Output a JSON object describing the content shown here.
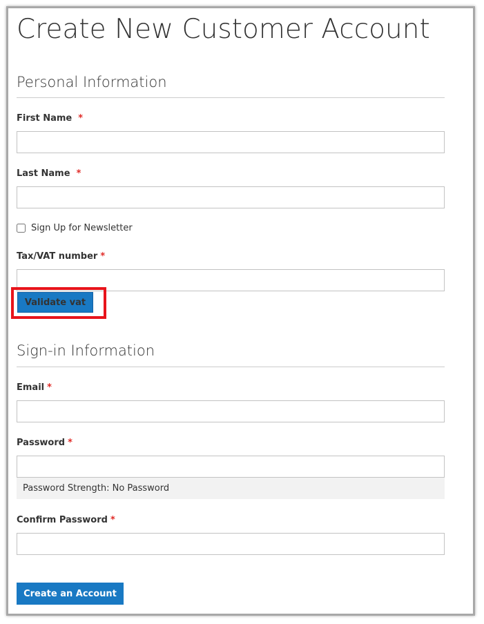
{
  "page": {
    "title": "Create New Customer Account"
  },
  "personal": {
    "section_title": "Personal Information",
    "first_name": {
      "label": "First Name",
      "required_mark": "*",
      "value": "",
      "placeholder": ""
    },
    "last_name": {
      "label": "Last Name",
      "required_mark": "*",
      "value": "",
      "placeholder": ""
    },
    "newsletter": {
      "label": "Sign Up for Newsletter",
      "checked": false
    },
    "tax_vat": {
      "label": "Tax/VAT number",
      "required_mark": "*",
      "value": "",
      "placeholder": ""
    },
    "validate_button_label": "Validate vat"
  },
  "signin": {
    "section_title": "Sign-in Information",
    "email": {
      "label": "Email",
      "required_mark": "*",
      "value": "",
      "placeholder": ""
    },
    "password": {
      "label": "Password",
      "required_mark": "*",
      "value": "",
      "placeholder": ""
    },
    "password_strength": "Password Strength: No Password",
    "confirm_password": {
      "label": "Confirm Password",
      "required_mark": "*",
      "value": "",
      "placeholder": ""
    }
  },
  "actions": {
    "create_account_label": "Create an Account"
  },
  "colors": {
    "primary_button": "#1979c3",
    "required_asterisk": "#e02b27",
    "highlight_annotation": "#e8141b",
    "strength_meter_bg": "#f2f2f2"
  }
}
